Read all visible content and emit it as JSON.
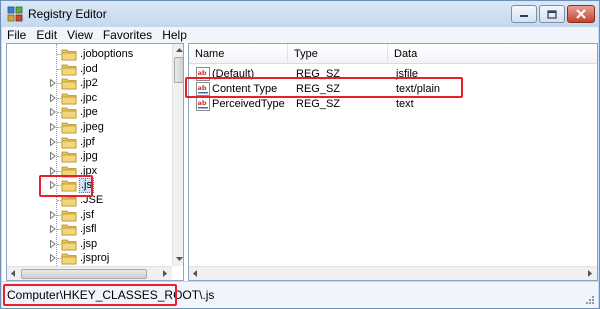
{
  "window": {
    "title": "Registry Editor"
  },
  "menu": [
    "File",
    "Edit",
    "View",
    "Favorites",
    "Help"
  ],
  "tree": {
    "items": [
      {
        "label": ".joboptions",
        "expandable": false,
        "selected": false
      },
      {
        "label": ".jod",
        "expandable": false,
        "selected": false
      },
      {
        "label": ".jp2",
        "expandable": true,
        "selected": false
      },
      {
        "label": ".jpc",
        "expandable": true,
        "selected": false
      },
      {
        "label": ".jpe",
        "expandable": true,
        "selected": false
      },
      {
        "label": ".jpeg",
        "expandable": true,
        "selected": false
      },
      {
        "label": ".jpf",
        "expandable": true,
        "selected": false
      },
      {
        "label": ".jpg",
        "expandable": true,
        "selected": false
      },
      {
        "label": ".jpx",
        "expandable": true,
        "selected": false
      },
      {
        "label": ".js",
        "expandable": true,
        "selected": true
      },
      {
        "label": ".JSE",
        "expandable": false,
        "selected": false
      },
      {
        "label": ".jsf",
        "expandable": true,
        "selected": false
      },
      {
        "label": ".jsfl",
        "expandable": true,
        "selected": false
      },
      {
        "label": ".jsp",
        "expandable": true,
        "selected": false
      },
      {
        "label": ".jsproj",
        "expandable": true,
        "selected": false
      }
    ]
  },
  "values": {
    "columns": {
      "name": "Name",
      "type": "Type",
      "data": "Data"
    },
    "rows": [
      {
        "name": "(Default)",
        "type": "REG_SZ",
        "data": "jsfile",
        "icon": "string-value-icon"
      },
      {
        "name": "Content Type",
        "type": "REG_SZ",
        "data": "text/plain",
        "icon": "string-value-icon"
      },
      {
        "name": "PerceivedType",
        "type": "REG_SZ",
        "data": "text",
        "icon": "string-value-icon"
      }
    ]
  },
  "status": {
    "path": "Computer\\HKEY_CLASSES_ROOT\\.js"
  },
  "colors": {
    "highlight": "#e8202a",
    "selection": "#cde4f9",
    "folder": "#e8c45a"
  }
}
